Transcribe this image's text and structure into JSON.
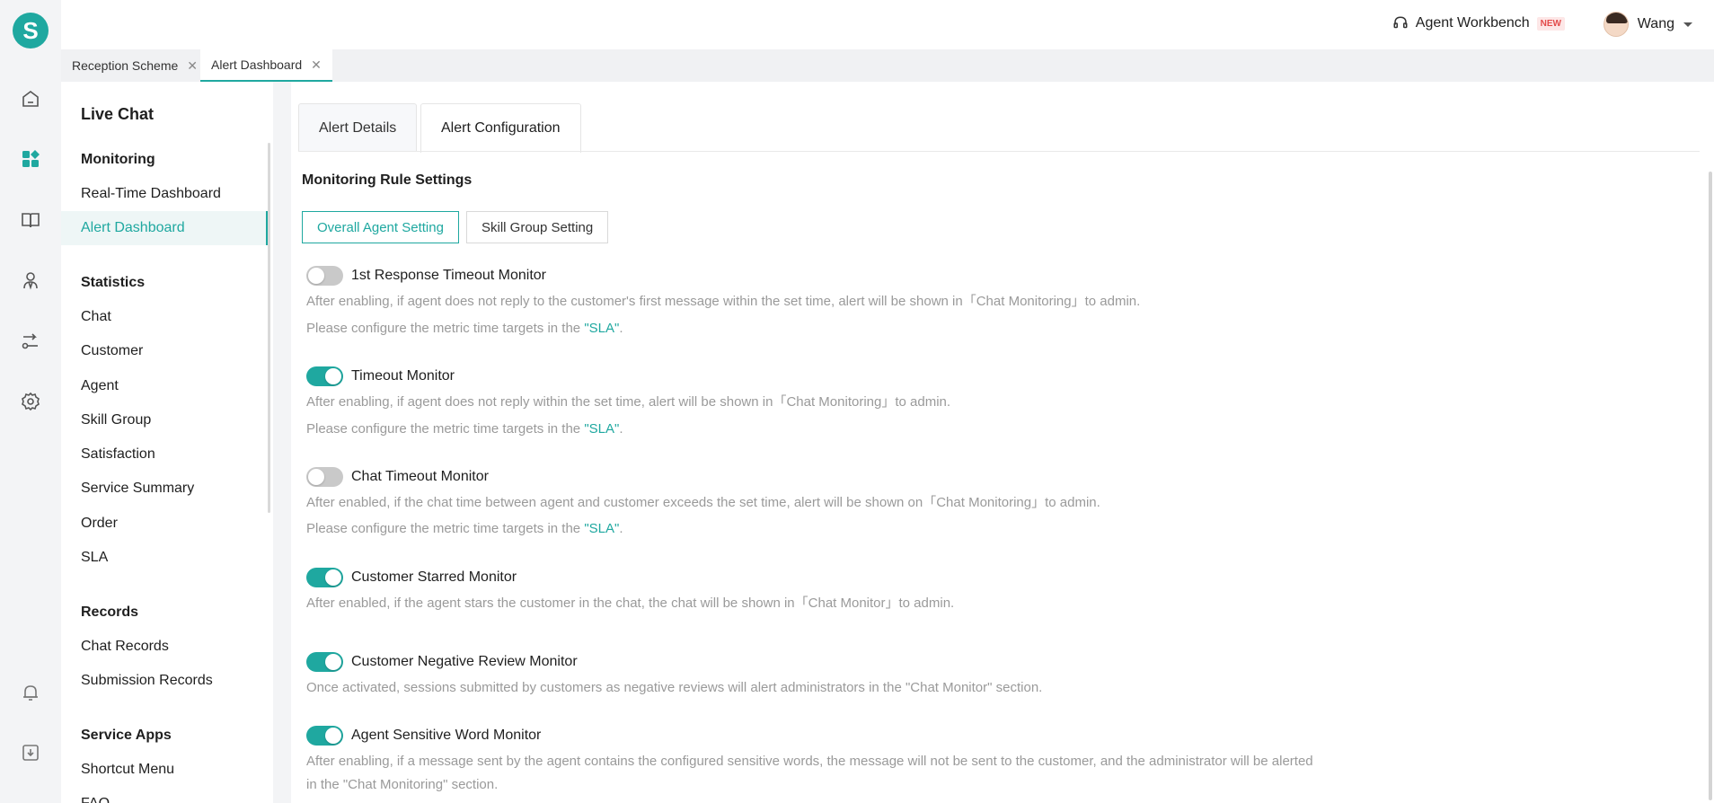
{
  "app": {
    "logo_letter": "S"
  },
  "topbar": {
    "workbench_label": "Agent Workbench",
    "new_badge": "NEW",
    "user_name": "Wang"
  },
  "page_tabs": [
    {
      "label": "Reception Scheme",
      "close": "✕"
    },
    {
      "label": "Alert Dashboard",
      "close": "✕"
    }
  ],
  "sidebar": {
    "title": "Live Chat",
    "sections": {
      "monitoring": "Monitoring",
      "statistics": "Statistics",
      "records": "Records",
      "service_apps": "Service Apps"
    },
    "items": {
      "real_time_dashboard": "Real-Time Dashboard",
      "alert_dashboard": "Alert Dashboard",
      "chat": "Chat",
      "customer": "Customer",
      "agent": "Agent",
      "skill_group": "Skill Group",
      "satisfaction": "Satisfaction",
      "service_summary": "Service Summary",
      "order": "Order",
      "sla": "SLA",
      "chat_records": "Chat Records",
      "submission_records": "Submission Records",
      "shortcut_menu": "Shortcut Menu",
      "faq": "FAQ"
    }
  },
  "content_tabs": {
    "details": "Alert Details",
    "configuration": "Alert Configuration"
  },
  "rule_settings": {
    "title": "Monitoring Rule Settings",
    "segments": {
      "overall": "Overall Agent Setting",
      "skill_group": "Skill Group Setting"
    }
  },
  "sla_hint": {
    "prefix": "Please configure the metric time targets in the ",
    "link": "\"SLA\"",
    "suffix": "."
  },
  "monitors": [
    {
      "title": "1st Response Timeout Monitor",
      "enabled": false,
      "desc": "After enabling, if agent does not reply to the customer's first message within the set time, alert will be shown in「Chat Monitoring」to admin."
    },
    {
      "title": "Timeout Monitor",
      "enabled": true,
      "desc": "After enabling, if agent does not reply within the set time, alert will be shown in「Chat Monitoring」to admin."
    },
    {
      "title": "Chat Timeout Monitor",
      "enabled": false,
      "desc": "After enabled, if the chat time between agent and customer exceeds the set time, alert will be shown on「Chat Monitoring」to admin."
    },
    {
      "title": "Customer Starred Monitor",
      "enabled": true,
      "desc": "After enabled, if the agent stars the customer in the chat, the chat will be shown in「Chat Monitor」to admin."
    },
    {
      "title": "Customer Negative Review Monitor",
      "enabled": true,
      "desc": "Once activated, sessions submitted by customers as negative reviews will alert administrators in the \"Chat Monitor\" section."
    },
    {
      "title": "Agent Sensitive Word Monitor",
      "enabled": true,
      "desc": "After enabling, if a message sent by the agent contains the configured sensitive words, the message will not be sent to the customer, and the administrator will be alerted in the \"Chat Monitoring\" section."
    }
  ],
  "colors": {
    "accent": "#1fa8a0",
    "muted_text": "#9a9a9a",
    "toggle_off": "#c9c9c9"
  }
}
